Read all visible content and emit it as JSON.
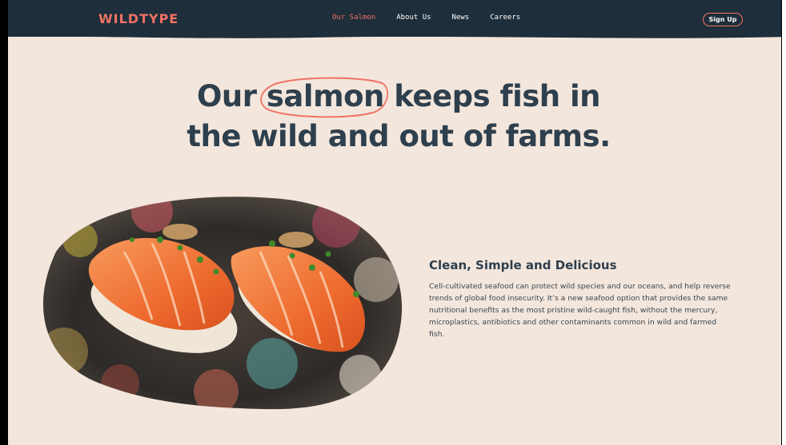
{
  "nav": {
    "logo": "WILDTYPE",
    "links": [
      {
        "label": "Our Salmon",
        "active": true
      },
      {
        "label": "About Us",
        "active": false
      },
      {
        "label": "News",
        "active": false
      },
      {
        "label": "Careers",
        "active": false
      }
    ],
    "signup_label": "Sign Up"
  },
  "hero": {
    "line1_before": "Our",
    "line1_circled": "salmon",
    "line1_after": "keeps fish in",
    "line2": "the wild and out of farms."
  },
  "feature": {
    "title": "Clean, Simple and Delicious",
    "body": "Cell-cultivated seafood can protect wild species and our oceans, and help reverse trends of global food insecurity. It’s a new seafood option that provides the same nutritional benefits as the most pristine wild-caught fish, without the mercury, microplastics, antibiotics and other contaminants common in wild and farmed fish."
  },
  "colors": {
    "nav_bg": "#1e2e3a",
    "accent": "#f07264",
    "page_bg": "#f3e6dc",
    "heading": "#2e3f4d"
  },
  "icons": {
    "image": "salmon-nigiri-image"
  }
}
